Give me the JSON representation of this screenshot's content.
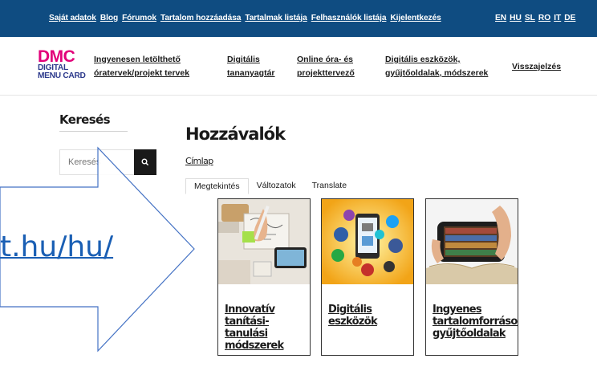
{
  "topbar": {
    "links": [
      "Saját adatok",
      "Blog",
      "Fórumok",
      "Tartalom hozzáadása",
      "Tartalmak listája",
      "Felhasználók listája",
      "Kijelentkezés"
    ],
    "languages": [
      "EN",
      "HU",
      "SL",
      "RO",
      "IT",
      "DE"
    ]
  },
  "logo": {
    "main": "DMC",
    "line1": "DIGITAL",
    "line2": "MENU CARD"
  },
  "mainnav": {
    "item1_l1": "Ingyenesen letölthető",
    "item1_l2": "óratervek/projekt tervek",
    "item2_l1": "Digitális",
    "item2_l2": "tananyagtár",
    "item3_l1": "Online óra- és",
    "item3_l2": "projekttervező",
    "item4_l1": "Digitális eszközök,",
    "item4_l2": "gyűjtőoldalak, módszerek",
    "item5": "Visszajelzés"
  },
  "sidebar": {
    "title": "Keresés",
    "search_placeholder": "Keresés"
  },
  "main": {
    "title": "Hozzávalók",
    "breadcrumb": "Címlap",
    "tabs": [
      "Megtekintés",
      "Változatok",
      "Translate"
    ],
    "cards": [
      {
        "l1": "Innovatív",
        "l2": "tanítási-tanulási",
        "l3": "módszerek"
      },
      {
        "l1": "Digitális eszközök",
        "l2": "",
        "l3": ""
      },
      {
        "l1": "Ingyenes",
        "l2": "tartalomforrások,",
        "l3": "gyűjtőoldalak"
      }
    ]
  },
  "overlay": {
    "url_text": "t.hu/hu/"
  },
  "colors": {
    "topbar": "#0f4c81",
    "logo_accent": "#e2007a",
    "logo_sub": "#2d3a8c",
    "arrow_border": "#4472c4",
    "url": "#1a5fb4"
  },
  "icons": {
    "search_button": "search-icon"
  }
}
